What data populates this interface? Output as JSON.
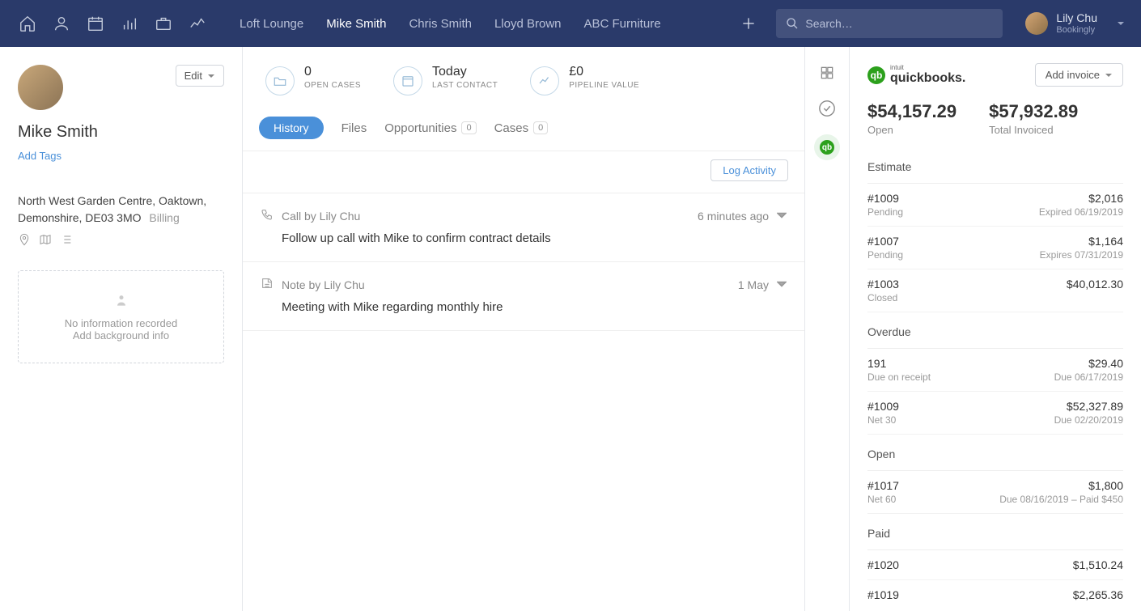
{
  "nav": {
    "tabs": [
      "Loft Lounge",
      "Mike Smith",
      "Chris Smith",
      "Lloyd Brown",
      "ABC Furniture"
    ],
    "active_index": 1,
    "search_placeholder": "Search…",
    "user_name": "Lily Chu",
    "user_org": "Bookingly"
  },
  "contact": {
    "name": "Mike Smith",
    "edit_label": "Edit",
    "add_tags_label": "Add Tags",
    "address_line1": "North West Garden Centre, Oaktown,",
    "address_line2": "Demonshire, DE03 3MO",
    "address_badge": "Billing",
    "bg_line1": "No information recorded",
    "bg_line2": "Add background info"
  },
  "stats": {
    "open_cases_val": "0",
    "open_cases_lab": "OPEN CASES",
    "last_contact_val": "Today",
    "last_contact_lab": "LAST CONTACT",
    "pipeline_val": "£0",
    "pipeline_lab": "PIPELINE VALUE"
  },
  "tabs": {
    "history": "History",
    "files": "Files",
    "opps": "Opportunities",
    "opps_count": "0",
    "cases": "Cases",
    "cases_count": "0"
  },
  "log_activity_label": "Log Activity",
  "activities": [
    {
      "icon": "phone",
      "title": "Call by Lily Chu",
      "time": "6 minutes ago",
      "body": "Follow up call with Mike to confirm contract details"
    },
    {
      "icon": "note",
      "title": "Note by Lily Chu",
      "time": "1 May",
      "body": "Meeting with Mike regarding monthly hire"
    }
  ],
  "qb": {
    "brand_small": "intuit",
    "brand": "quickbooks.",
    "add_invoice_label": "Add invoice",
    "open_amount": "$54,157.29",
    "open_label": "Open",
    "total_amount": "$57,932.89",
    "total_label": "Total Invoiced",
    "sections": [
      {
        "title": "Estimate",
        "items": [
          {
            "id": "#1009",
            "sub": "Pending",
            "amt": "$2,016",
            "rsub": "Expired 06/19/2019"
          },
          {
            "id": "#1007",
            "sub": "Pending",
            "amt": "$1,164",
            "rsub": "Expires 07/31/2019"
          },
          {
            "id": "#1003",
            "sub": "Closed",
            "amt": "$40,012.30",
            "rsub": ""
          }
        ]
      },
      {
        "title": "Overdue",
        "items": [
          {
            "id": "191",
            "sub": "Due on receipt",
            "amt": "$29.40",
            "rsub": "Due 06/17/2019"
          },
          {
            "id": "#1009",
            "sub": "Net 30",
            "amt": "$52,327.89",
            "rsub": "Due 02/20/2019"
          }
        ]
      },
      {
        "title": "Open",
        "items": [
          {
            "id": "#1017",
            "sub": "Net 60",
            "amt": "$1,800",
            "rsub": "Due 08/16/2019 – Paid $450"
          }
        ]
      },
      {
        "title": "Paid",
        "items": [
          {
            "id": "#1020",
            "sub": "",
            "amt": "$1,510.24",
            "rsub": ""
          },
          {
            "id": "#1019",
            "sub": "",
            "amt": "$2,265.36",
            "rsub": ""
          }
        ]
      }
    ]
  }
}
